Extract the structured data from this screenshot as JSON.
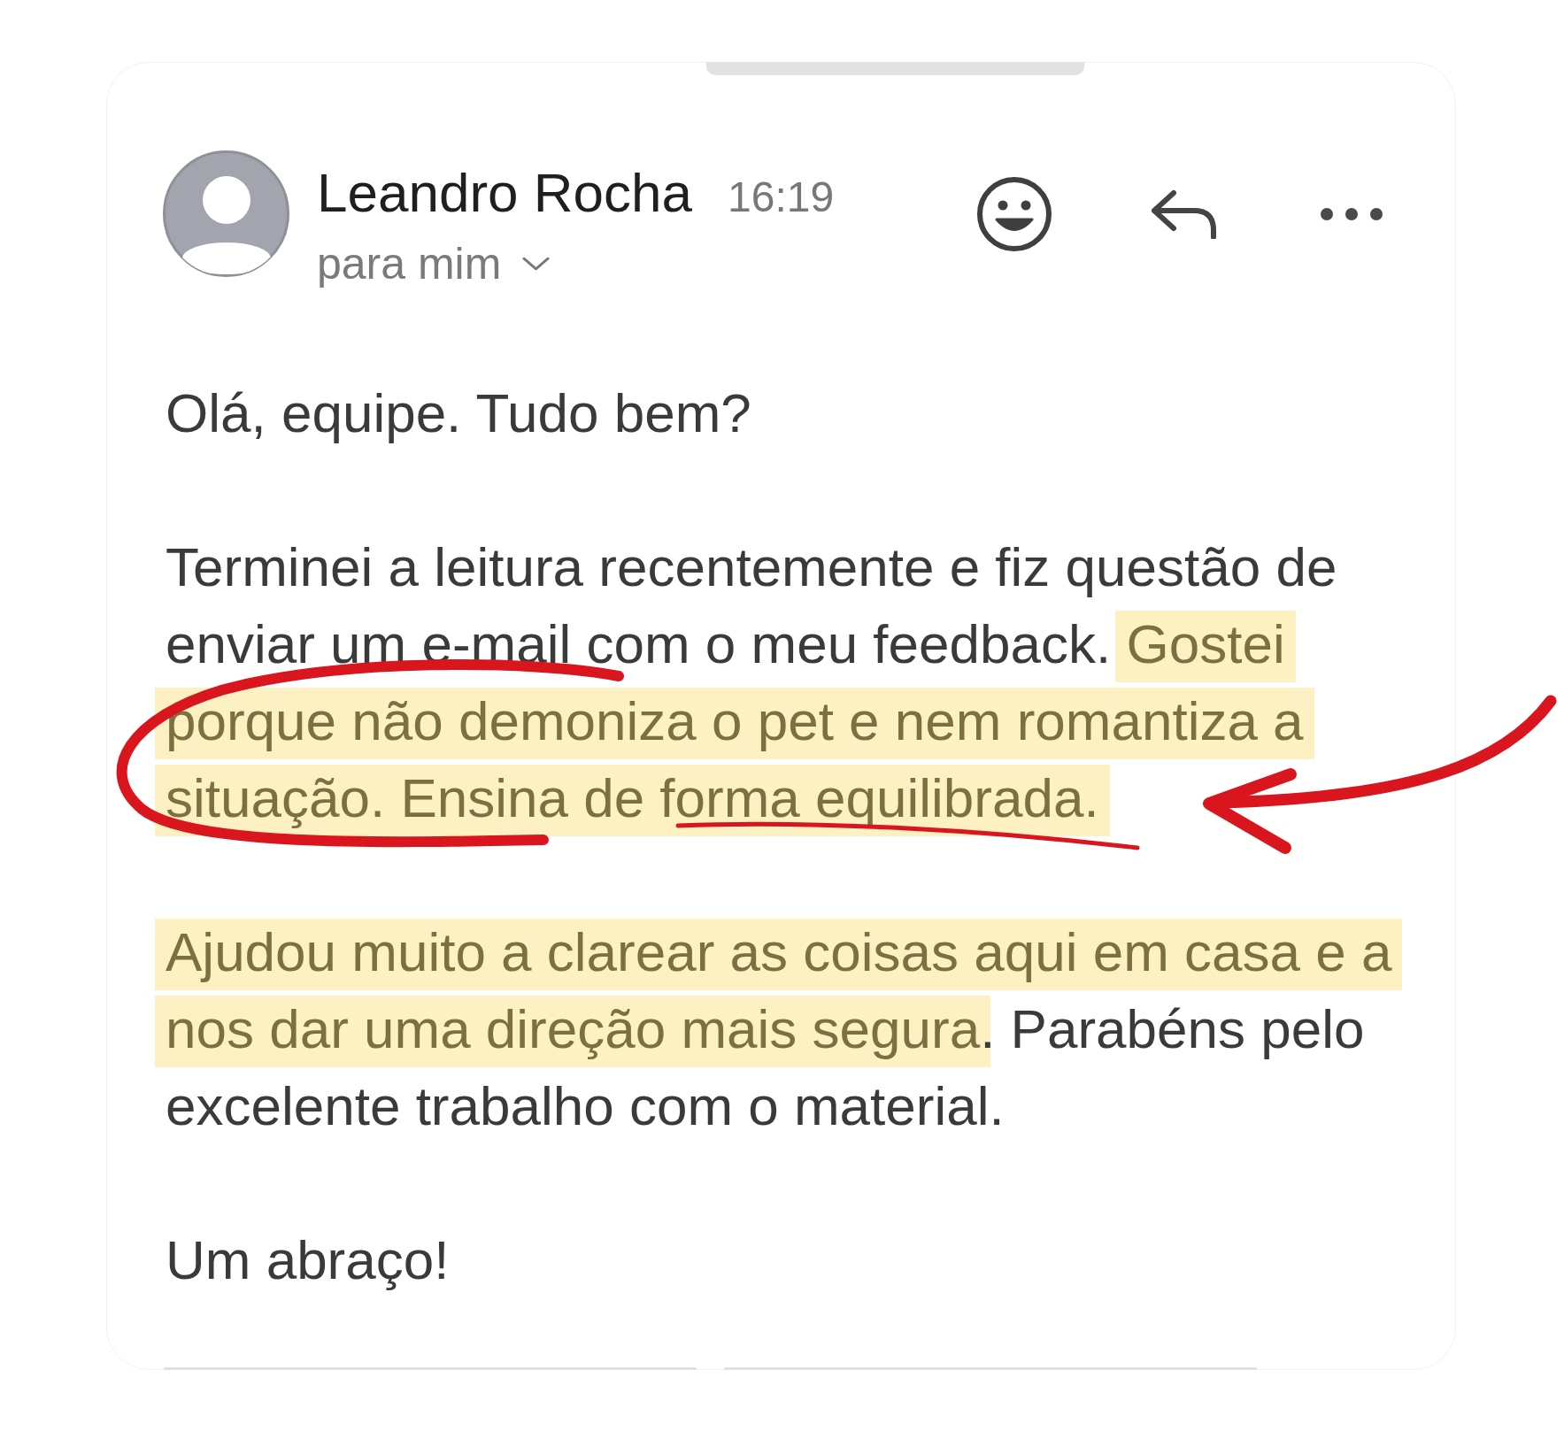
{
  "email": {
    "sender": "Leandro Rocha",
    "time": "16:19",
    "recipient": "para mim"
  },
  "body": [
    {
      "segments": [
        {
          "text": "Olá, equipe. Tudo bem?",
          "highlighted": false
        }
      ]
    },
    {
      "segments": [
        {
          "text": "Terminei a leitura recentemente e fiz questão de enviar um e-mail com o meu feedback. ",
          "highlighted": false
        },
        {
          "text": "Gostei porque não demoniza o pet e nem romantiza a situação. Ensina de forma equilibrada.",
          "highlighted": true
        }
      ]
    },
    {
      "segments": [
        {
          "text": "Ajudou muito a clarear as coisas aqui em casa e a nos dar uma direção mais segura",
          "highlighted": true
        },
        {
          "text": ". Parabéns pelo excelente trabalho com o material.",
          "highlighted": false
        }
      ]
    },
    {
      "segments": [
        {
          "text": "Um abraço!",
          "highlighted": false
        }
      ]
    }
  ],
  "annotations": [
    {
      "kind": "loop"
    },
    {
      "kind": "underline"
    },
    {
      "kind": "arrow"
    }
  ]
}
